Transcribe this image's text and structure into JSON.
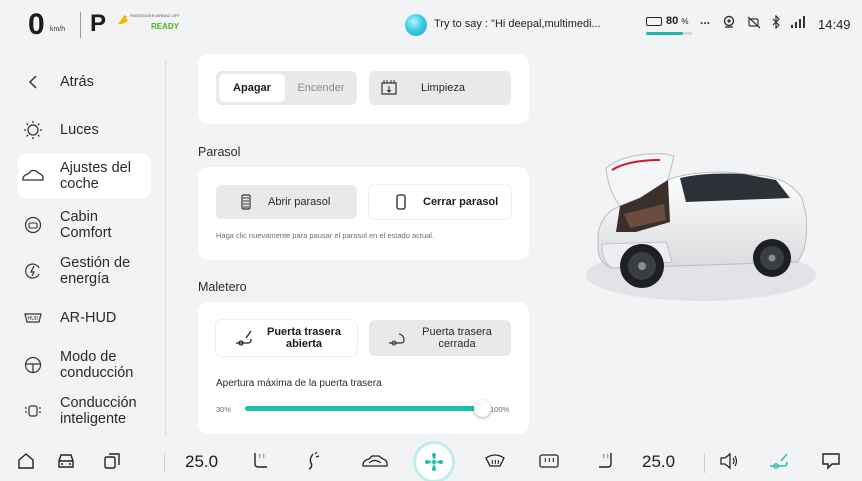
{
  "status": {
    "speed": "0",
    "speed_unit": "km/h",
    "gear": "P",
    "airbag_label": "PASSENGER AIRBAG OFF",
    "ready": "READY",
    "voice_hint": "Try to say : \"Hi deepal,multimedi...",
    "battery_percent": "80",
    "battery_unit": "%",
    "battery_level": 0.8,
    "more": "...",
    "time": "14:49"
  },
  "sidebar": {
    "back": "Atrás",
    "items": [
      {
        "label": "Luces",
        "icon": "sun-icon"
      },
      {
        "label": "Ajustes del coche",
        "icon": "car-icon",
        "active": true
      },
      {
        "label": "Cabin Comfort",
        "icon": "cabin-icon"
      },
      {
        "label": "Gestión de energía",
        "icon": "energy-icon"
      },
      {
        "label": "AR-HUD",
        "icon": "hud-icon"
      },
      {
        "label": "Modo de conducción",
        "icon": "steering-wheel-icon"
      },
      {
        "label": "Conducción inteligente",
        "icon": "smart-driving-icon"
      }
    ]
  },
  "wiper": {
    "apagar": "Apagar",
    "encender": "Encender",
    "limpieza": "Limpieza"
  },
  "parasol": {
    "title": "Parasol",
    "open": "Abrir parasol",
    "close": "Cerrar parasol",
    "hint": "Haga clic nuevamente para pausar el parasol en el estado actual."
  },
  "maletero": {
    "title": "Maletero",
    "open": "Puerta trasera abierta",
    "closed": "Puerta trasera cerrada",
    "slider_title": "Apertura máxima de la puerta trasera",
    "slider_min": "30%",
    "slider_max": "100%",
    "slider_value_fraction": 1.0
  },
  "dock": {
    "temp_left": "25.0",
    "temp_right": "25.0"
  },
  "colors": {
    "accent": "#1fbfae",
    "ready": "#49b516",
    "background": "#f2f3f5"
  }
}
